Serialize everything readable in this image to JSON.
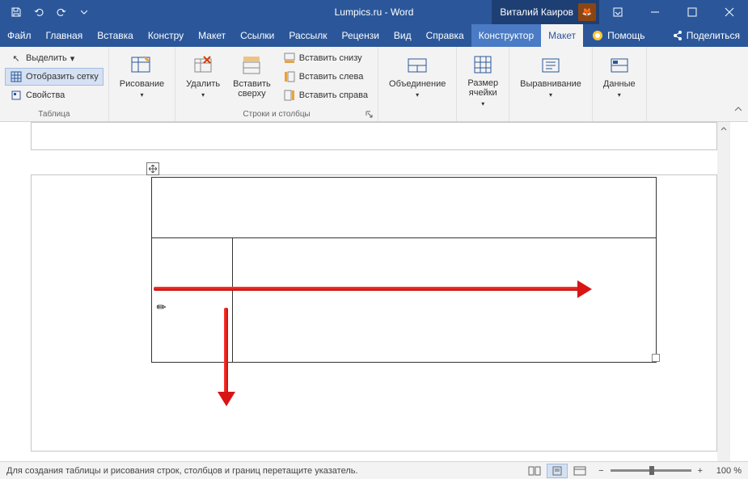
{
  "titlebar": {
    "document_title": "Lumpics.ru - Word",
    "user_name": "Виталий Каиров"
  },
  "tabs": {
    "file": "Файл",
    "home": "Главная",
    "insert": "Вставка",
    "design": "Констру",
    "layout": "Макет",
    "references": "Ссылки",
    "mailings": "Рассылк",
    "review": "Рецензи",
    "view": "Вид",
    "help": "Справка",
    "table_design": "Конструктор",
    "table_layout": "Макет",
    "assist": "Помощь",
    "share": "Поделиться"
  },
  "ribbon": {
    "group_table": {
      "label": "Таблица",
      "select": "Выделить",
      "view_gridlines": "Отобразить сетку",
      "properties": "Свойства"
    },
    "group_draw": {
      "draw_table": "Рисование"
    },
    "group_rows_cols": {
      "label": "Строки и столбцы",
      "delete": "Удалить",
      "insert_above": "Вставить\nсверху",
      "insert_below": "Вставить снизу",
      "insert_left": "Вставить слева",
      "insert_right": "Вставить справа"
    },
    "group_merge": {
      "merge": "Объединение"
    },
    "group_cell_size": {
      "cell_size": "Размер\nячейки"
    },
    "group_alignment": {
      "alignment": "Выравнивание"
    },
    "group_data": {
      "data": "Данные"
    }
  },
  "statusbar": {
    "message": "Для создания таблицы и рисования строк, столбцов и границ перетащите указатель.",
    "zoom_level": "100 %",
    "zoom_minus": "−",
    "zoom_plus": "+"
  }
}
